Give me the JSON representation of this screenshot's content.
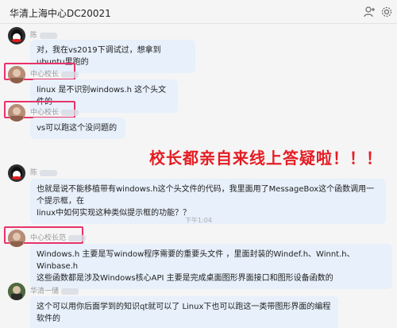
{
  "window": {
    "title": "华清上海中心DC20021"
  },
  "toolbar": {
    "add_user_icon": "add-user-icon",
    "settings_icon": "gear-icon"
  },
  "overlay": {
    "text": "校长都亲自来线上答疑啦！！！"
  },
  "timestamp": "下午1:04",
  "messages": [
    {
      "sender": "陈",
      "text": "对，我在vs2019下调试过，想拿到ubuntu里跑的"
    },
    {
      "sender": "中心校长",
      "text": "linux 是不识别windows.h 这个头文件的"
    },
    {
      "sender": "中心校长",
      "text": "vs可以跑这个没问题的"
    },
    {
      "sender": "陈",
      "text_lines": [
        "也就是说不能移植带有windows.h这个头文件的代码，我里面用了MessageBox这个函数调用一个提示框，在",
        "linux中如何实现这种类似提示框的功能？？"
      ]
    },
    {
      "sender": "中心校长范",
      "text_lines": [
        "Windows.h 主要是写window程序需要的重要头文件 ，里面封装的Windef.h、Winnt.h、Winbase.h",
        "这些函数都是涉及Windows核心API    主要是完成桌面图形界面接口和图形设备函数的"
      ]
    },
    {
      "sender": "华清一储",
      "text": "这个可以用你后面学到的知识qt就可以了 Linux下也可以跑这一类带图形界面的编程软件的"
    }
  ],
  "colors": {
    "highlight": "#e8336a",
    "overlay": "#e51c23",
    "bubble": "#e7f0fb"
  }
}
